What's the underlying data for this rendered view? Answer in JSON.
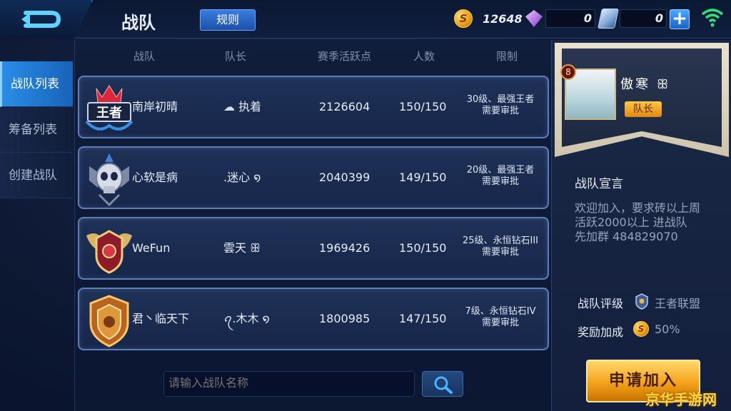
{
  "header": {
    "title": "战队",
    "rules_label": "规则",
    "gold": "12648",
    "diamonds": "0",
    "vouchers": "0",
    "plus_label": "+"
  },
  "nav": {
    "items": [
      {
        "label": "战队列表"
      },
      {
        "label": "筹备列表"
      },
      {
        "label": "创建战队"
      }
    ]
  },
  "table": {
    "headers": [
      "战队",
      "队长",
      "赛季活跃点",
      "人数",
      "限制"
    ],
    "rows": [
      {
        "name": "南岸初晴",
        "leader_icon": "☁",
        "leader": "执着",
        "points": "2126604",
        "members": "150/150",
        "limit_1": "30级、最强王者",
        "limit_2": "需要审批",
        "badge": "king-crown-badge"
      },
      {
        "name": "心软是病",
        "leader_icon": "",
        "leader": ".迷心 ໑",
        "points": "2040399",
        "members": "149/150",
        "limit_1": "20级、最强王者",
        "limit_2": "需要审批",
        "badge": "skull-badge"
      },
      {
        "name": "WeFun",
        "leader_icon": "",
        "leader": "雲天 ꕥ",
        "points": "1969426",
        "members": "150/150",
        "limit_1": "25级、永恒钻石III",
        "limit_2": "需要审批",
        "badge": "winged-shield-badge"
      },
      {
        "name": "君丶临天下",
        "leader_icon": "",
        "leader": "ꪖ.木木 ໑",
        "points": "1800985",
        "members": "147/150",
        "limit_1": "7级、永恒钻石IV",
        "limit_2": "需要审批",
        "badge": "gold-shield-badge"
      }
    ]
  },
  "search": {
    "placeholder": "请输入战队名称"
  },
  "detail": {
    "level": "8",
    "leader_name": "傲寒 ꕥ",
    "leader_tag": "队长",
    "declaration_title": "战队宣言",
    "declaration_lines": [
      "欢迎加入，要求砖以上周",
      "活跃2000以上  进战队",
      "先加群  484829070"
    ],
    "rating_label": "战队评级",
    "rating_value": "王者联盟",
    "bonus_label": "奖励加成",
    "bonus_value": "50%",
    "apply_label": "申请加入"
  },
  "watermark": "京华手游网",
  "colors": {
    "accent": "#2a8de8",
    "gold": "#f3a21c"
  }
}
